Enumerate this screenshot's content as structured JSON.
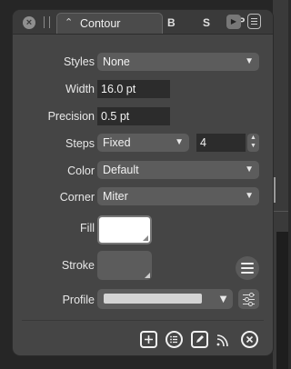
{
  "tabs": {
    "active_label": "Contour",
    "tab_b": "B",
    "tab_s": "S",
    "tab_p": "P"
  },
  "rows": {
    "styles": {
      "label": "Styles",
      "value": "None"
    },
    "width": {
      "label": "Width",
      "value": "16.0 pt"
    },
    "precision": {
      "label": "Precision",
      "value": "0.5 pt"
    },
    "steps": {
      "label": "Steps",
      "mode": "Fixed",
      "count": "4"
    },
    "color": {
      "label": "Color",
      "value": "Default"
    },
    "corner": {
      "label": "Corner",
      "value": "Miter"
    },
    "fill": {
      "label": "Fill",
      "swatch_color": "#ffffff"
    },
    "stroke": {
      "label": "Stroke",
      "swatch_color": "#5c5c5c"
    },
    "profile": {
      "label": "Profile"
    }
  },
  "icons": {
    "close": "close-icon",
    "drag_handle": "grip-icon",
    "tab_chevron": "chevron-updown-icon",
    "play": "play-icon",
    "panel_menu": "menu-icon",
    "stroke_menu": "hamburger-icon",
    "profile_settings": "sliders-icon",
    "add": "add-square-icon",
    "list": "list-icon",
    "edit": "edit-icon",
    "curve": "curve-icon",
    "remove": "remove-circle-icon"
  }
}
